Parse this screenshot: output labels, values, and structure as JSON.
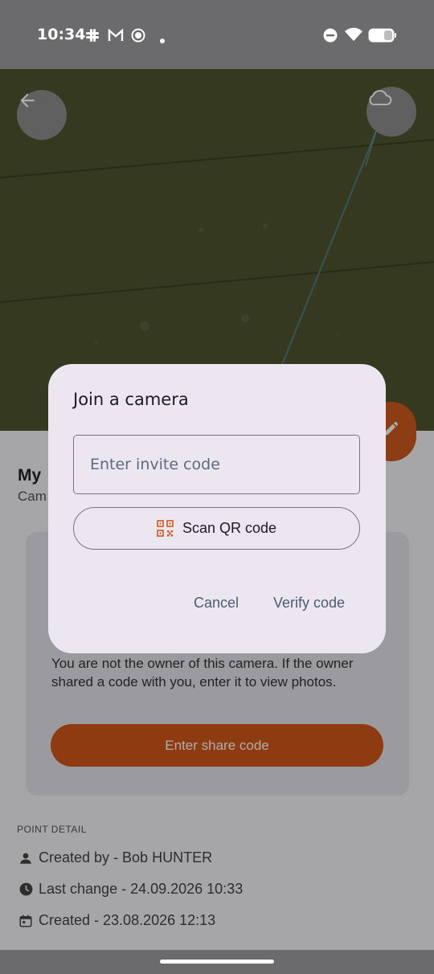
{
  "status_bar": {
    "time": "10:34"
  },
  "sheet": {
    "title": "My",
    "subtitle": "Cam",
    "card_text": "You are not the owner of this camera. If the owner shared a code with you, enter it to view photos.",
    "share_button": "Enter share code",
    "section_label": "POINT DETAIL",
    "created_by": "Created by - Bob HUNTER",
    "last_change": "Last change - 24.09.2026 10:33",
    "created": "Created - 23.08.2026 12:13"
  },
  "dialog": {
    "title": "Join a camera",
    "input_placeholder": "Enter invite code",
    "input_value": "",
    "scan_qr_label": "Scan QR code",
    "cancel_label": "Cancel",
    "verify_label": "Verify code"
  },
  "colors": {
    "accent": "#d3571a",
    "dialog_bg": "#ece6f0",
    "action_text": "#4e5a72"
  },
  "icons": [
    "back-arrow-icon",
    "cloud-icon",
    "edit-pencil-icon",
    "person-icon",
    "clock-icon",
    "calendar-icon",
    "qr-code-icon",
    "wifi-icon",
    "battery-icon"
  ]
}
